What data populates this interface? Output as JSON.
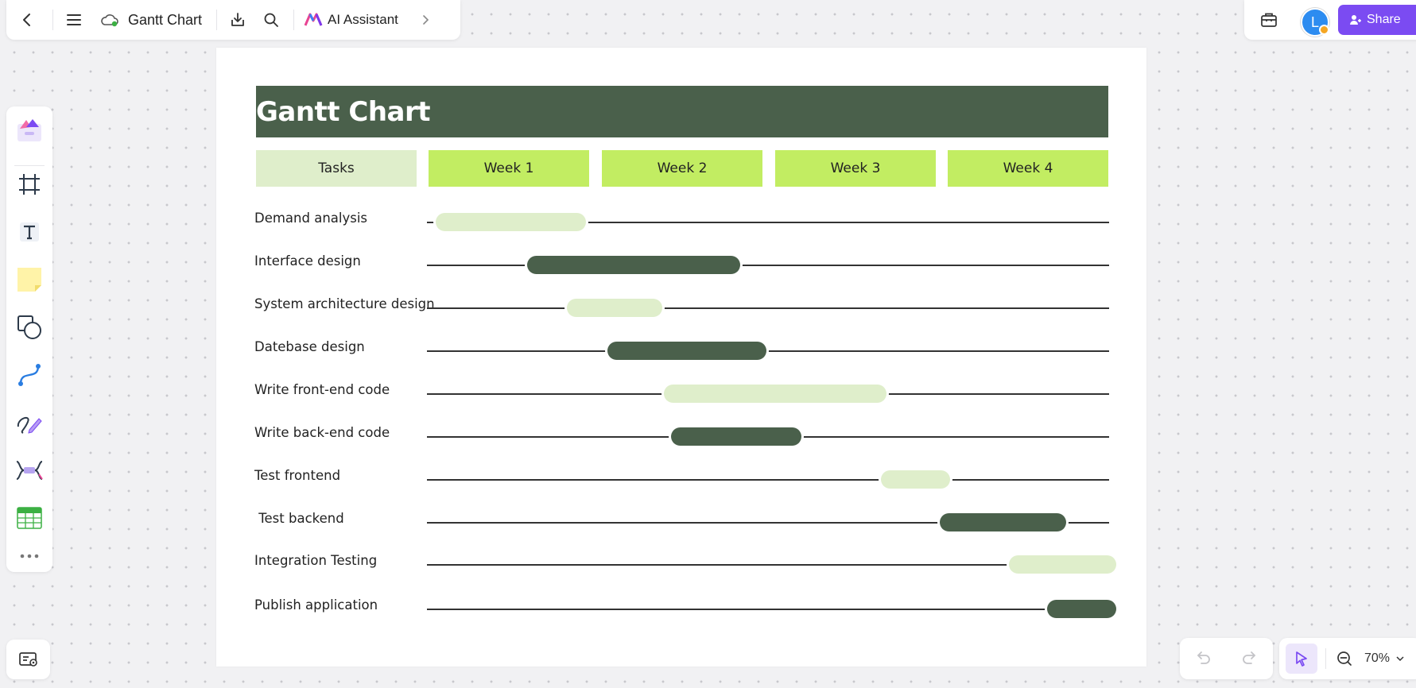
{
  "toolbar": {
    "doc_title": "Gantt Chart",
    "ai_label": "AI Assistant",
    "icons": [
      "back-icon",
      "menu-icon",
      "cloud-saved-icon",
      "download-icon",
      "search-icon",
      "ai-logo-icon",
      "chevron-right-icon"
    ]
  },
  "topright": {
    "avatar_initial": "L",
    "share_label": "Share"
  },
  "zoom": {
    "level": "70%"
  },
  "colors": {
    "accent": "#7b4bf2",
    "title_bar": "#4a604b",
    "week_header": "#c2ed62",
    "tasks_header": "#dfeecb",
    "bar_light": "#dfeecb",
    "bar_dark": "#4a604b"
  },
  "chart_data": {
    "type": "gantt",
    "title": "Gantt Chart",
    "columns": [
      "Tasks",
      "Week 1",
      "Week 2",
      "Week 3",
      "Week 4"
    ],
    "tasks": [
      {
        "name": "Demand analysis",
        "start": 0.04,
        "end": 0.91,
        "style": "light"
      },
      {
        "name": "Interface design",
        "start": 0.57,
        "end": 1.8,
        "style": "dark"
      },
      {
        "name": "System architecture design",
        "start": 0.8,
        "end": 1.35,
        "style": "light"
      },
      {
        "name": "Datebase design",
        "start": 1.03,
        "end": 1.95,
        "style": "dark"
      },
      {
        "name": "Write front-end code",
        "start": 1.36,
        "end": 2.64,
        "style": "light"
      },
      {
        "name": "Write back-end code",
        "start": 1.4,
        "end": 2.15,
        "style": "dark"
      },
      {
        "name": "Test frontend",
        "start": 2.61,
        "end": 3.01,
        "style": "light"
      },
      {
        "name": " Test backend",
        "start": 2.95,
        "end": 3.68,
        "style": "dark"
      },
      {
        "name": "Integration Testing",
        "start": 3.35,
        "end": 3.97,
        "style": "light"
      },
      {
        "name": "Publish application",
        "start": 3.57,
        "end": 3.97,
        "style": "dark"
      }
    ]
  }
}
